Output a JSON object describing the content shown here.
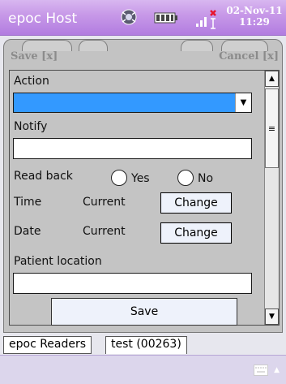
{
  "statusbar": {
    "app_title": "epoc Host",
    "date": "02-Nov-11",
    "time": "11:29"
  },
  "form": {
    "header_left": "Save [x]",
    "header_right": "Cancel [x]",
    "action_label": "Action",
    "action_value": "",
    "notify_label": "Notify",
    "notify_value": "",
    "readback_label": "Read back",
    "readback_yes": "Yes",
    "readback_no": "No",
    "time_label": "Time",
    "time_value": "Current",
    "time_change": "Change",
    "date_label": "Date",
    "date_value": "Current",
    "date_change": "Change",
    "patient_location_label": "Patient location",
    "patient_location_value": "",
    "save_button": "Save"
  },
  "bottom_tabs": [
    {
      "label": "epoc Readers"
    },
    {
      "label": "test (00263)"
    }
  ],
  "colors": {
    "titlebar": "#b27ce0",
    "selection": "#3399ff"
  }
}
